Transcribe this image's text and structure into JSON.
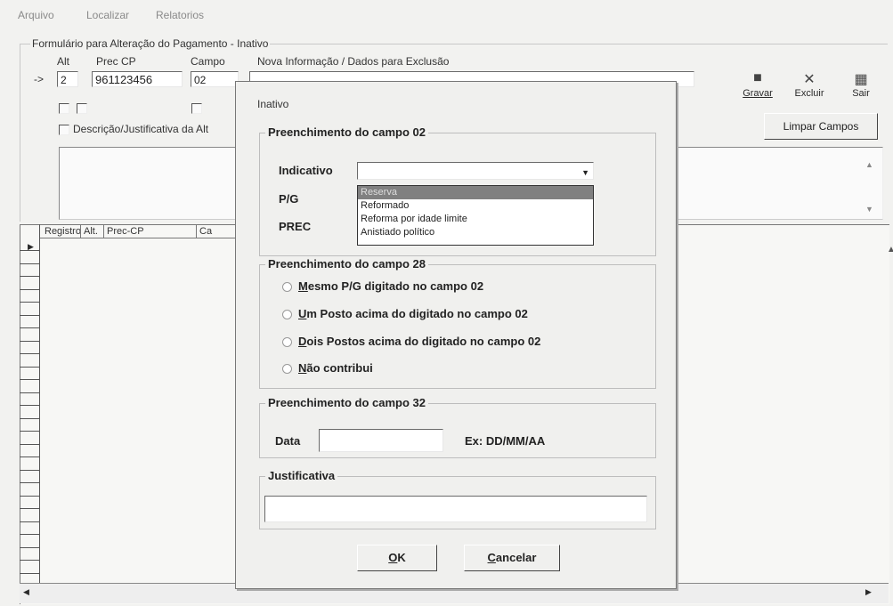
{
  "menu": [
    "Arquivo",
    "Localizar",
    "Relatorios"
  ],
  "form": {
    "title": "Formulário para Alteração do Pagamento - Inativo",
    "col_alt": "Alt",
    "col_prec": "Prec CP",
    "col_campo": "Campo",
    "col_nova": "Nova Informação / Dados para Exclusão",
    "arrow": "->",
    "alt_value": "2",
    "prec_value": "961123456",
    "campo_value": "02",
    "descricao_label": "Descrição/Justificativa da Alt"
  },
  "toolbar": {
    "gravar": "Gravar",
    "excluir": "Excluir",
    "sair": "Sair",
    "limpar": "Limpar Campos"
  },
  "grid": {
    "headers": [
      "Registro",
      "Alt.",
      "Prec-CP",
      "Ca"
    ],
    "row_marker": "▶"
  },
  "dialog": {
    "title": "Inativo",
    "group1_title": "Preenchimento do campo 02",
    "indicativo_label": "Indicativo",
    "pg_label": "P/G",
    "prec_label": "PREC",
    "dropdown_options": [
      "Reserva",
      "Reformado",
      "Reforma por idade limite",
      "Anistiado político"
    ],
    "dropdown_selected_index": 0,
    "group2_title": "Preenchimento do campo 28",
    "radio_options": [
      {
        "u": "M",
        "rest": "esmo P/G digitado no campo 02"
      },
      {
        "u": "U",
        "rest": "m Posto acima do digitado no campo 02"
      },
      {
        "u": "D",
        "rest": "ois Postos acima do digitado no campo 02"
      },
      {
        "u": "N",
        "rest": "ão contribui"
      }
    ],
    "group3_title": "Preenchimento do campo 32",
    "data_label": "Data",
    "data_value": "",
    "data_hint": "Ex: DD/MM/AA",
    "group4_title": "Justificativa",
    "justificativa_value": "",
    "ok_u": "O",
    "ok_rest": "K",
    "cancel_u": "C",
    "cancel_rest": "ancelar"
  }
}
